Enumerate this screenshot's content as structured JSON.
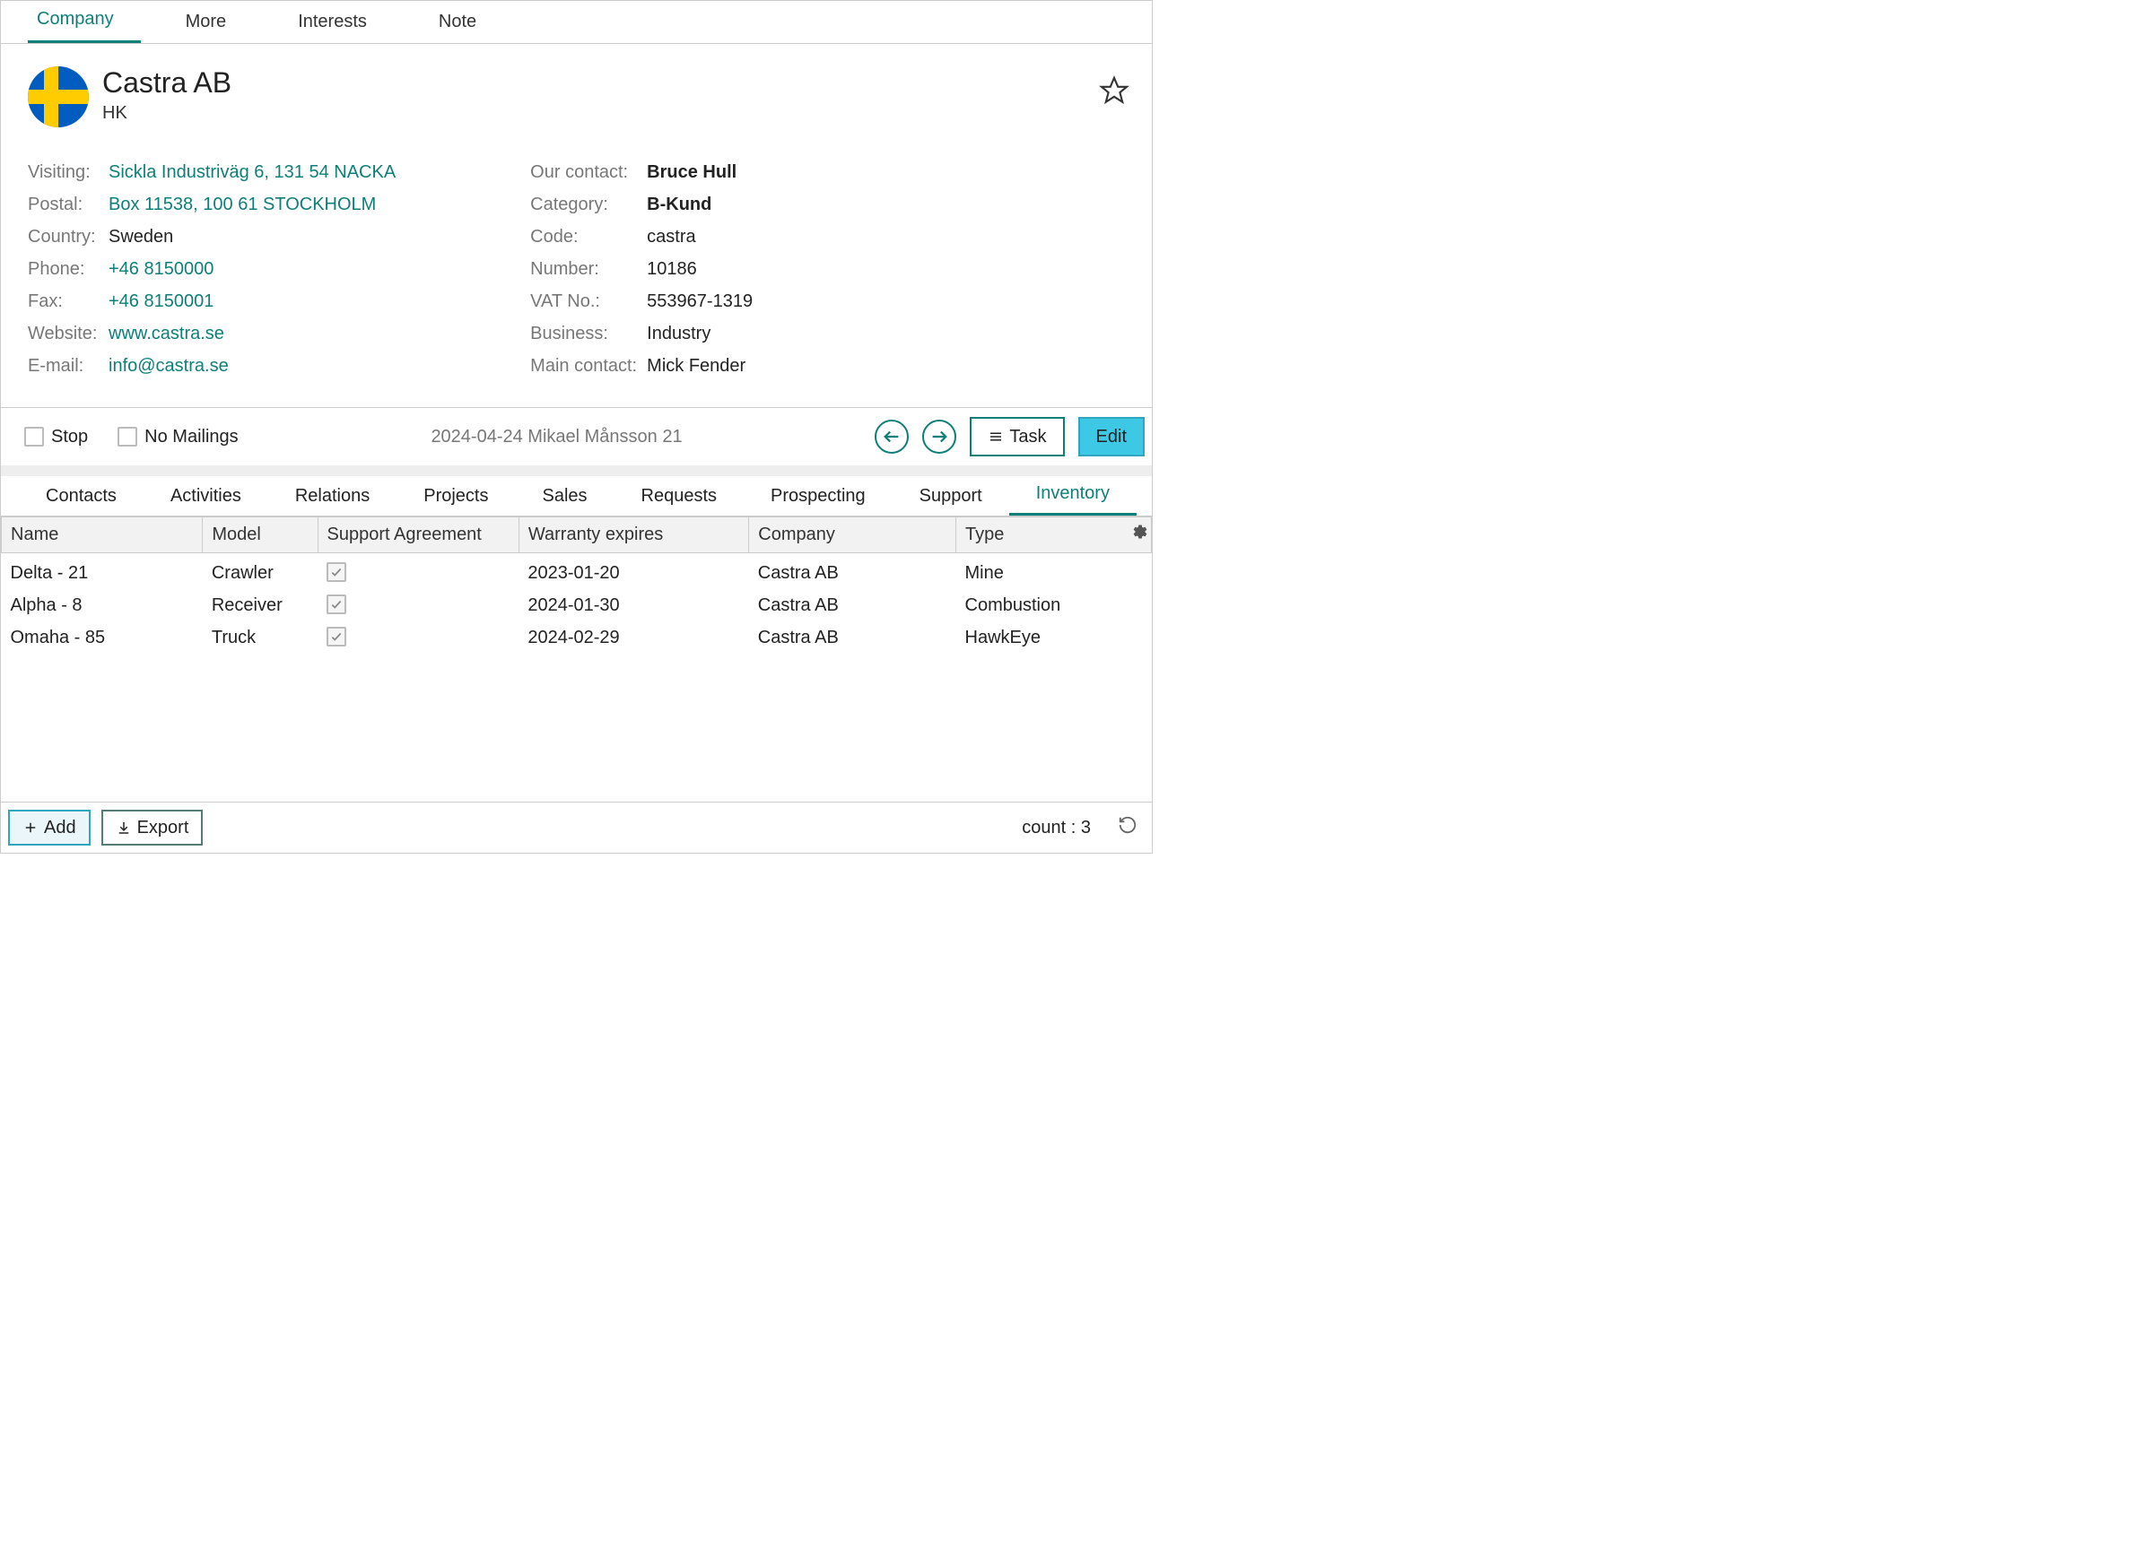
{
  "top_tabs": [
    "Company",
    "More",
    "Interests",
    "Note"
  ],
  "company": {
    "name": "Castra AB",
    "sub": "HK"
  },
  "left_details": {
    "visiting_label": "Visiting:",
    "visiting": "Sickla Industriväg 6, 131 54 NACKA",
    "postal_label": "Postal:",
    "postal": "Box 11538, 100 61 STOCKHOLM",
    "country_label": "Country:",
    "country": "Sweden",
    "phone_label": "Phone:",
    "phone": "+46 8150000",
    "fax_label": "Fax:",
    "fax": "+46 8150001",
    "website_label": "Website:",
    "website": "www.castra.se",
    "email_label": "E-mail:",
    "email": "info@castra.se"
  },
  "right_details": {
    "our_contact_label": "Our contact:",
    "our_contact": "Bruce Hull",
    "category_label": "Category:",
    "category": "B-Kund",
    "code_label": "Code:",
    "code": "castra",
    "number_label": "Number:",
    "number": "10186",
    "vat_label": "VAT No.:",
    "vat": "553967-1319",
    "business_label": "Business:",
    "business": "Industry",
    "main_contact_label": "Main contact:",
    "main_contact": "Mick Fender"
  },
  "action_bar": {
    "stop_label": "Stop",
    "no_mailings_label": "No Mailings",
    "status": "2024-04-24 Mikael Månsson 21",
    "task": "Task",
    "edit": "Edit"
  },
  "lower_tabs": [
    "Contacts",
    "Activities",
    "Relations",
    "Projects",
    "Sales",
    "Requests",
    "Prospecting",
    "Support",
    "Inventory"
  ],
  "table": {
    "headers": {
      "name": "Name",
      "model": "Model",
      "support": "Support Agreement",
      "warranty": "Warranty expires",
      "company": "Company",
      "type": "Type"
    },
    "rows": [
      {
        "name": "Delta - 21",
        "model": "Crawler",
        "support": true,
        "warranty": "2023-01-20",
        "company": "Castra AB",
        "type": "Mine"
      },
      {
        "name": "Alpha - 8",
        "model": "Receiver",
        "support": true,
        "warranty": "2024-01-30",
        "company": "Castra AB",
        "type": "Combustion"
      },
      {
        "name": "Omaha - 85",
        "model": "Truck",
        "support": true,
        "warranty": "2024-02-29",
        "company": "Castra AB",
        "type": "HawkEye"
      }
    ]
  },
  "footer": {
    "add": "Add",
    "export": "Export",
    "count": "count : 3"
  }
}
